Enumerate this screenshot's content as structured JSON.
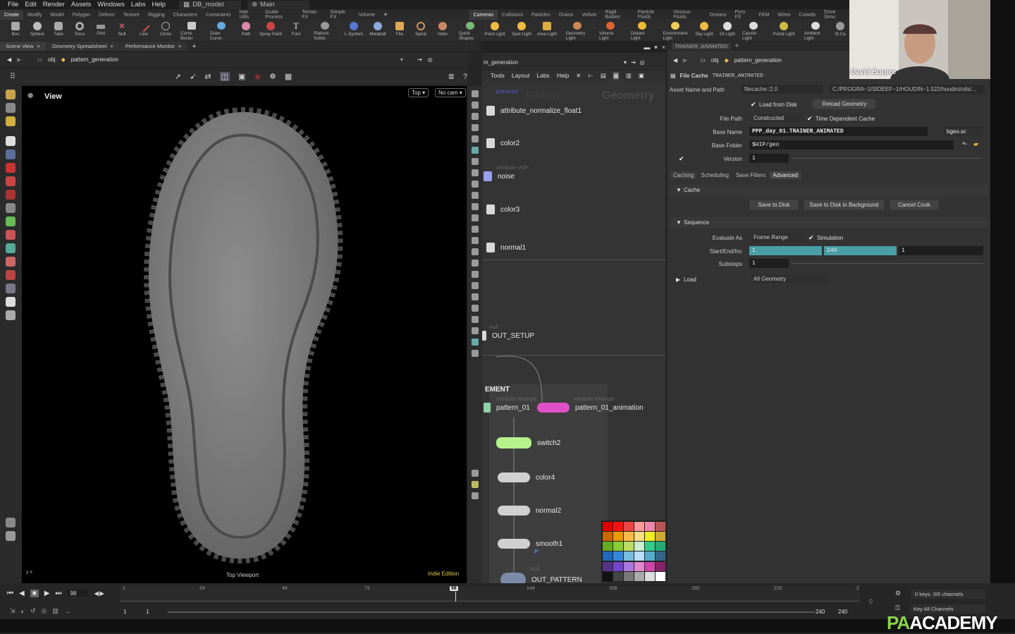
{
  "menubar": {
    "items": [
      "File",
      "Edit",
      "Render",
      "Assets",
      "Windows",
      "Labs",
      "Help"
    ],
    "desktop": "DB_model",
    "workspace": "Main"
  },
  "shelf_tabs_left": [
    "Create",
    "Modify",
    "Model",
    "Polygon",
    "Deform",
    "Texture",
    "Rigging",
    "Characters",
    "Constraints",
    "Hair Utils",
    "Guide Process",
    "Terrain FX",
    "Simple FX",
    "Volume"
  ],
  "shelf_tabs_right": [
    "Cameras",
    "Collisions",
    "Particles",
    "Grains",
    "Vellum",
    "Rigid Bodies",
    "Particle Fluids",
    "Viscous Fluids",
    "Oceans",
    "Pyro FX",
    "FEM",
    "Wires",
    "Crowds",
    "Drive Simu"
  ],
  "shelf_tools_left": [
    "Box",
    "Sphere",
    "Tube",
    "Torus",
    "Grid",
    "Null",
    "Line",
    "Circle",
    "Curve Bezier",
    "Draw Curve",
    "Path",
    "Spray Paint",
    "Font",
    "Platonic Solids",
    "L-System",
    "Metaball",
    "File",
    "Spiral",
    "Helix"
  ],
  "shelf_tools_right": [
    "Quick Shapes",
    "Point Light",
    "Spot Light",
    "Area Light",
    "Geometry Light",
    "Volume Light",
    "Distant Light",
    "Environment Light",
    "Sky Light",
    "GI Light",
    "Caustic Light",
    "Portal Light",
    "Ambient Light",
    "St Ca"
  ],
  "pane_tabs": [
    "Scene View",
    "Geometry Spreadsheet",
    "Performance Monitor"
  ],
  "left_path": {
    "root": "obj",
    "node": "pattern_generation"
  },
  "viewport": {
    "title": "View",
    "cam_top": "Top",
    "cam_nocam": "No cam",
    "label": "Top Viewport",
    "edition": "Indie Edition",
    "axis": "y x"
  },
  "network": {
    "path_node": "m_generation",
    "menu": [
      "Tools",
      "Layout",
      "Labs",
      "Help"
    ],
    "watermark_edition": "Edition",
    "watermark_geo": "Geometry",
    "pressure": "pressure",
    "nodes": {
      "n1": "attribute_normalize_float1",
      "n2": "color2",
      "n3": "noise",
      "n3sub": "Attribute VOP",
      "n4": "color3",
      "n5": "normal1",
      "n6": "OUT_SETUP",
      "n6sub": "Null",
      "box": "EMENT",
      "n7": "pattern_01",
      "n7sub": "Attribute Wrangle",
      "n8": "pattern_01_animation",
      "n8sub": "Attribute Wrangle",
      "n9": "switch2",
      "n10": "color4",
      "n11": "normal2",
      "n12": "smooth1",
      "n12sub": "P",
      "n13": "OUT_PATTERN",
      "n13sub": "Null"
    }
  },
  "params": {
    "tab": "TRAINER_ANIMATED",
    "path_root": "obj",
    "path_node": "pattern_generation",
    "type": "File Cache",
    "name": "TRAINER_ANIMATED",
    "asset_label": "Asset Name and Path",
    "asset_value": "filecache::2.0",
    "asset_path": "C:/PROGRA~1/SIDEEF~1/HOUDIN~1.522/houdini/otls/...",
    "load_from_disk": "Load from Disk",
    "reload": "Reload Geometry",
    "file_path_label": "File Path",
    "file_path_value": "Constructed",
    "time_dep": "Time Dependent Cache",
    "base_name_label": "Base Name",
    "base_name_value": "PPP_day_01.TRAINER_ANIMATED",
    "ext": "bgeo.sc",
    "base_folder_label": "Base Folder",
    "base_folder_value": "$HIP/geo",
    "version_label": "Version",
    "version_value": "1",
    "tabs": [
      "Caching",
      "Scheduling",
      "Save Filters",
      "Advanced"
    ],
    "cache_section": "Cache",
    "save_disk": "Save to Disk",
    "save_bg": "Save to Disk in Background",
    "cancel": "Cancel Cook",
    "seq_section": "Sequence",
    "eval_label": "Evaluate As",
    "eval_value": "Frame Range",
    "simulation": "Simulation",
    "sei_label": "Start/End/Inc",
    "start": "1",
    "end": "240",
    "inc": "1",
    "substeps_label": "Substeps",
    "substeps_value": "1",
    "load_section": "Load",
    "load_value": "All Geometry"
  },
  "webcam": {
    "name": "David Burpee"
  },
  "timeline": {
    "current_frame": "98",
    "ticks": [
      "1",
      "24",
      "48",
      "72",
      "98",
      "144",
      "168",
      "192",
      "216",
      "2"
    ],
    "range_start": "1",
    "range_start2": "1",
    "range_end": "240",
    "range_end2": "240",
    "keys": "0 keys, 0/0 channels",
    "key_all": "Key All Channels"
  },
  "logo": {
    "a": "PA",
    "b": "ACADEMY"
  }
}
